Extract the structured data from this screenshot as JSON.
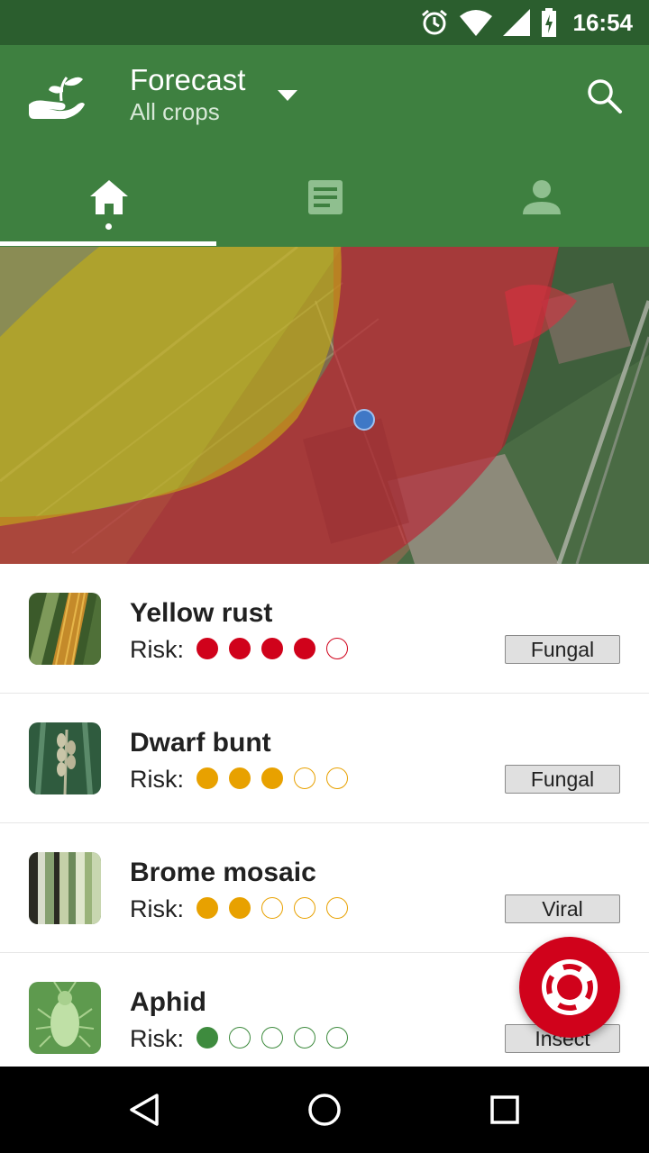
{
  "status_bar": {
    "time": "16:54",
    "icons": [
      "alarm-icon",
      "wifi-icon",
      "signal-icon",
      "battery-charging-icon"
    ]
  },
  "app_bar": {
    "title": "Forecast",
    "subtitle": "All crops",
    "logo": "hand-sprout-logo",
    "dropdown_icon": "caret-down-icon",
    "search_icon": "search-icon"
  },
  "tabs": [
    {
      "icon": "home-icon",
      "selected": true
    },
    {
      "icon": "list-icon",
      "selected": false
    },
    {
      "icon": "person-icon",
      "selected": false
    }
  ],
  "map": {
    "location_marker": "location-dot"
  },
  "colors": {
    "primary": "#3e8040",
    "primary_dark": "#2b5e2e",
    "risk_high": "#d0021b",
    "risk_medium": "#e8a100",
    "risk_low": "#3e8b3e",
    "fab": "#d0021b"
  },
  "risk_prefix": "Risk:",
  "items": [
    {
      "name": "Yellow rust",
      "risk": 4,
      "max_risk": 5,
      "risk_color": "#d0021b",
      "category": "Fungal",
      "thumb": "yellow-rust-leaf"
    },
    {
      "name": "Dwarf bunt",
      "risk": 3,
      "max_risk": 5,
      "risk_color": "#e8a100",
      "category": "Fungal",
      "thumb": "wheat-ear"
    },
    {
      "name": "Brome mosaic",
      "risk": 2,
      "max_risk": 5,
      "risk_color": "#e8a100",
      "category": "Viral",
      "thumb": "striped-leaves"
    },
    {
      "name": "Aphid",
      "risk": 1,
      "max_risk": 5,
      "risk_color": "#3e8b3e",
      "category": "Insect",
      "thumb": "aphid-insect"
    }
  ],
  "fab": {
    "icon": "lifebuoy-icon"
  },
  "nav_bar": {
    "icons": [
      "back-icon",
      "home-circle-icon",
      "recents-icon"
    ]
  }
}
